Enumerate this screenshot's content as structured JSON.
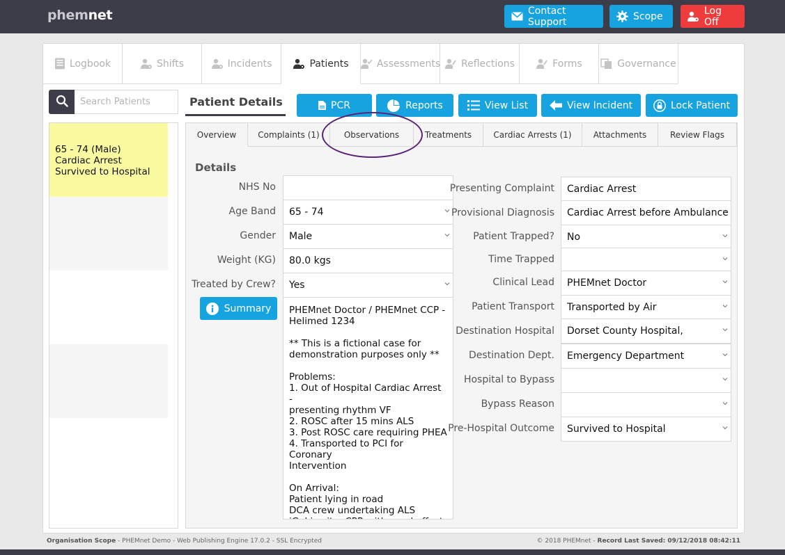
{
  "app": {
    "logo_part1": "phem",
    "logo_part2": "net"
  },
  "topbar": {
    "contact_support": "Contact Support",
    "scope": "Scope",
    "log_off": "Log Off"
  },
  "main_tabs": [
    "Logbook",
    "Shifts",
    "Incidents",
    "Patients",
    "Assessments",
    "Reflections",
    "Forms",
    "Governance"
  ],
  "search": {
    "placeholder": "Search Patients"
  },
  "patient_list": [
    {
      "line1": "65 - 74 (Male)",
      "line2": "Cardiac Arrest",
      "line3": "Survived to Hospital"
    }
  ],
  "patient_details": {
    "title": "Patient Details",
    "actions": {
      "pcr": "PCR",
      "reports": "Reports",
      "view_list": "View List",
      "view_incident": "View Incident",
      "lock_patient": "Lock Patient"
    }
  },
  "sub_tabs": [
    "Overview",
    "Complaints (1)",
    "Observations",
    "Treatments",
    "Cardiac Arrests (1)",
    "Attachments",
    "Review Flags"
  ],
  "details": {
    "heading": "Details",
    "left": {
      "nhs_no_label": "NHS No",
      "nhs_no": "",
      "age_band_label": "Age Band",
      "age_band": "65 - 74",
      "gender_label": "Gender",
      "gender": "Male",
      "weight_label": "Weight (KG)",
      "weight": "80.0 kgs",
      "treated_label": "Treated by Crew?",
      "treated": "Yes",
      "summary_button": "Summary",
      "notes": "PHEMnet Doctor / PHEMnet CCP -\nHelimed 1234\n\n** This is a fictional case for\ndemonstration purposes only **\n\nProblems:\n1. Out of Hospital Cardiac Arrest -\npresenting rhythm VF\n2. ROSC after 15 mins ALS\n3. Post ROSC care requiring PHEA\n4. Transported to PCI for Coronary\nIntervention\n\nOn Arrival:\nPatient lying in road\nDCA crew undertaking ALS\niGel in situ, CPR with good effect\nPresenting rhythm Ventricular"
    },
    "right": {
      "presenting_complaint_label": "Presenting Complaint",
      "presenting_complaint": "Cardiac Arrest",
      "provisional_diagnosis_label": "Provisional Diagnosis",
      "provisional_diagnosis": "Cardiac Arrest before Ambulance",
      "patient_trapped_label": "Patient Trapped?",
      "patient_trapped": "No",
      "time_trapped_label": "Time Trapped",
      "time_trapped": "",
      "clinical_lead_label": "Clinical Lead",
      "clinical_lead": "PHEMnet Doctor",
      "patient_transport_label": "Patient Transport",
      "patient_transport": "Transported by Air",
      "destination_hospital_label": "Destination Hospital",
      "destination_hospital": "Dorset County Hospital,",
      "destination_dept_label": "Destination Dept.",
      "destination_dept": "Emergency Department",
      "hospital_bypass_label": "Hospital to Bypass",
      "hospital_bypass": "",
      "bypass_reason_label": "Bypass Reason",
      "bypass_reason": "",
      "outcome_label": "Pre-Hospital Outcome",
      "outcome": "Survived to Hospital"
    }
  },
  "footer": {
    "left_bold": "Organisation Scope",
    "left_rest": " - PHEMnet Demo - Web Publishing Engine 17.0.2 - SSL Encrypted",
    "right_rest": "© 2018 PHEMnet - ",
    "right_bold": "Record Last Saved: 09/12/2018 08:42:11"
  },
  "colors": {
    "accent": "#17a2e0",
    "danger": "#ee3c3c",
    "dark": "#3d3d49",
    "highlight": "#fafaa0",
    "annotation": "#5a2377"
  }
}
